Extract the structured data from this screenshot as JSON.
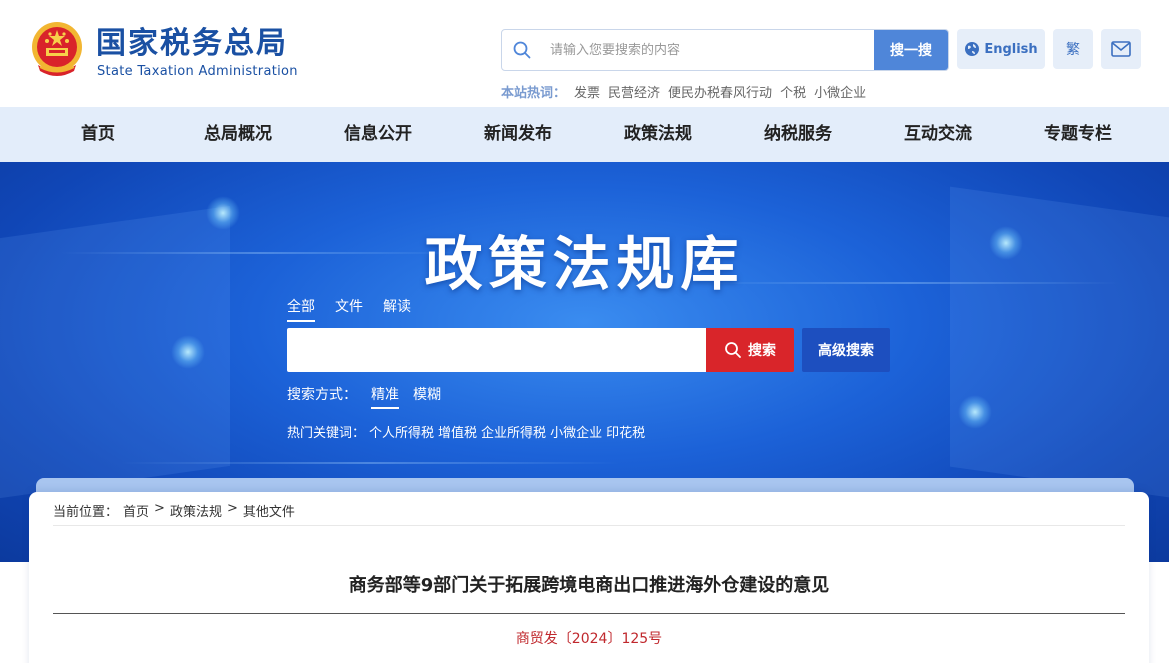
{
  "header": {
    "logo_cn": "国家税务总局",
    "logo_en": "State Taxation Administration",
    "search": {
      "placeholder": "请输入您要搜索的内容",
      "button_label": "搜一搜"
    },
    "english_label": "English",
    "traditional_label": "繁",
    "hotwords": {
      "label": "本站热词：",
      "items": [
        "发票",
        "民营经济",
        "便民办税春风行动",
        "个税",
        "小微企业"
      ]
    }
  },
  "nav": {
    "items": [
      "首页",
      "总局概况",
      "信息公开",
      "新闻发布",
      "政策法规",
      "纳税服务",
      "互动交流",
      "专题专栏"
    ]
  },
  "banner": {
    "title": "政策法规库",
    "tabs": [
      {
        "label": "全部",
        "active": true
      },
      {
        "label": "文件",
        "active": false
      },
      {
        "label": "解读",
        "active": false
      }
    ],
    "search_value": "",
    "search_button": "搜索",
    "advanced_button": "高级搜索",
    "mode_label": "搜索方式：",
    "modes": [
      {
        "label": "精准",
        "active": true
      },
      {
        "label": "模糊",
        "active": false
      }
    ],
    "hot_keywords_label": "热门关键词：",
    "hot_keywords": [
      "个人所得税",
      "增值税",
      "企业所得税",
      "小微企业",
      "印花税"
    ]
  },
  "content": {
    "breadcrumb": {
      "label": "当前位置：",
      "items": [
        "首页",
        "政策法规",
        "其他文件"
      ],
      "separator": ">"
    },
    "title": "商务部等9部门关于拓展跨境电商出口推进海外仓建设的意见",
    "doc_number": "商贸发〔2024〕125号"
  },
  "colors": {
    "brand_blue": "#1a50a3",
    "nav_bg": "#e3edfa",
    "search_red": "#d9252a",
    "doc_number_red": "#c0282d"
  }
}
